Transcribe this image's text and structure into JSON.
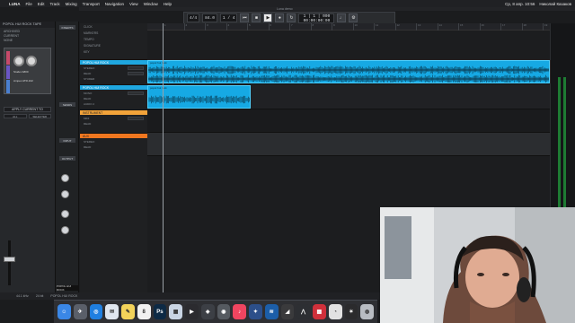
{
  "menubar": {
    "app": "LUNA",
    "items": [
      "File",
      "Edit",
      "Track",
      "Mixing",
      "Transport",
      "Navigation",
      "View",
      "Window",
      "Help"
    ],
    "date": "Ср, 8 апр. 10:56",
    "user": "Николай Казаков"
  },
  "window_title": "Luna demo",
  "transport": {
    "tempo": "84.0",
    "meter": "1 / 4",
    "time_sig": "4/4",
    "position_top": "1 | 1 | 000",
    "position_bottom": "00:00:00:00"
  },
  "left_panel": {
    "title": "POPOL HUI ROCK TAPE",
    "tabs": [
      "ARCHIVED",
      "CURRENT",
      "NONE"
    ],
    "tape_labels": [
      "Studer A800",
      "Ampex ATR-102"
    ],
    "apply_button": "APPLY CURRENT TO",
    "preset_buttons": [
      "ALL",
      "SELECTED"
    ],
    "colors": {
      "strip_a": "#c64a6a",
      "strip_b": "#6a56c4",
      "strip_c": "#4a7fd0"
    }
  },
  "inspector": {
    "buttons": [
      "INSERTS",
      "SENDS",
      "INPUT",
      "OUTPUT"
    ],
    "track_name": "POPOL HUI ROCK"
  },
  "track_headers": {
    "rows": [
      "CLICK",
      "MARKERS",
      "TEMPO",
      "SIGNATURE",
      "KEY"
    ],
    "tracks": [
      {
        "name": "POPOL HUI ROCK",
        "color": "#1fa7e0",
        "subs": [
          "STEREO",
          "READ",
          "STUDER"
        ]
      },
      {
        "name": "POPOL HUI ROCK",
        "color": "#1fa7e0",
        "subs": [
          "MONO",
          "READ",
          "AUDIO 2"
        ]
      },
      {
        "name": "INSTRUMENT",
        "color": "#f2a33a",
        "subs": [
          "MIDI",
          "READ"
        ]
      },
      {
        "name": "AUX",
        "color": "#f0771f",
        "subs": [
          "STEREO",
          "READ"
        ]
      }
    ]
  },
  "timeline": {
    "ruler_ticks": [
      "1",
      "2",
      "3",
      "4",
      "5",
      "6",
      "7",
      "8",
      "9",
      "10",
      "11",
      "12",
      "13",
      "14",
      "15",
      "16",
      "17",
      "18",
      "19"
    ],
    "regions": [
      {
        "label": "popol hui rock"
      },
      {
        "label": "popol hui rock"
      }
    ]
  },
  "status_bar": {
    "items": [
      "44.1 kHz",
      "24 bit",
      "POPOL HUI ROCK"
    ]
  },
  "dock": {
    "apps": [
      {
        "name": "finder-app",
        "glyph": "☺",
        "color": "#3a87e6"
      },
      {
        "name": "launchpad-app",
        "glyph": "✈",
        "color": "#5a5f69"
      },
      {
        "name": "safari-app",
        "glyph": "◎",
        "color": "#1f7fe0"
      },
      {
        "name": "mail-app",
        "glyph": "✉",
        "color": "#dfe6ef"
      },
      {
        "name": "notes-app",
        "glyph": "✎",
        "color": "#f3d35a"
      },
      {
        "name": "calendar-app",
        "glyph": "8",
        "color": "#f1f1f1"
      },
      {
        "name": "photoshop-app",
        "glyph": "Ps",
        "color": "#0d2a45"
      },
      {
        "name": "finder-files-app",
        "glyph": "▦",
        "color": "#c9d5e4"
      },
      {
        "name": "final-cut-app",
        "glyph": "▶",
        "color": "#2b2b2f"
      },
      {
        "name": "compressor-app",
        "glyph": "◈",
        "color": "#3c3f45"
      },
      {
        "name": "screenshot-app",
        "glyph": "◉",
        "color": "#555a60"
      },
      {
        "name": "music-app",
        "glyph": "♪",
        "color": "#f04560"
      },
      {
        "name": "uad-console-app",
        "glyph": "✦",
        "color": "#2c4f8a"
      },
      {
        "name": "audio-app",
        "glyph": "≋",
        "color": "#1c5ea8"
      },
      {
        "name": "logic-app",
        "glyph": "◢",
        "color": "#3a3a3c"
      },
      {
        "name": "luna-app",
        "glyph": "⋀",
        "color": "#2d2f33"
      },
      {
        "name": "grid-app",
        "glyph": "▩",
        "color": "#d0303b"
      },
      {
        "name": "speedometer-app",
        "glyph": "◔",
        "color": "#e2e2e2"
      },
      {
        "name": "settings-app",
        "glyph": "✶",
        "color": "#2b2b2d"
      },
      {
        "name": "trash-app",
        "glyph": "◍",
        "color": "#b8bcc2"
      }
    ]
  }
}
